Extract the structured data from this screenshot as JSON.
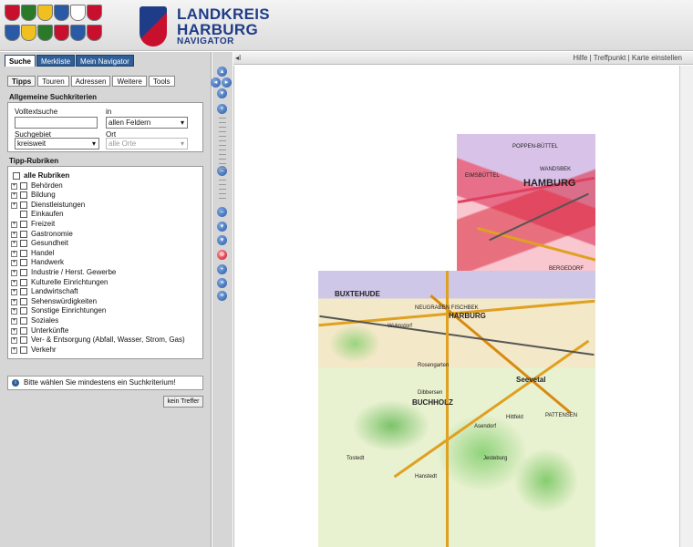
{
  "header": {
    "crests": [
      "#c8102e",
      "#2a7a2a",
      "#f0c020",
      "#2a5aa6",
      "#ffffff",
      "#c8102e",
      "#2a5aa6",
      "#f0c020",
      "#2a7a2a",
      "#c8102e",
      "#2a5aa6",
      "#c8102e"
    ],
    "logo": {
      "line1": "LANDKREIS",
      "line2": "HARBURG",
      "line3": "NAVIGATOR"
    }
  },
  "left": {
    "toptabs": [
      "Suche",
      "Merkliste",
      "Mein Navigator"
    ],
    "subtabs": [
      "Tipps",
      "Touren",
      "Adressen",
      "Weitere",
      "Tools"
    ],
    "general": {
      "title": "Allgemeine Suchkriterien",
      "volltext_label": "Volltextsuche",
      "volltext_value": "",
      "in_label": "in",
      "in_value": "allen Feldern",
      "suchgebiet_label": "Suchgebiet",
      "suchgebiet_value": "kreisweit",
      "ort_label": "Ort",
      "ort_value": "alle Orte"
    },
    "rubriken": {
      "title": "Tipp-Rubriken",
      "all_label": "alle Rubriken",
      "items": [
        "Behörden",
        "Bildung",
        "Dienstleistungen",
        "Einkaufen",
        "Freizeit",
        "Gastronomie",
        "Gesundheit",
        "Handel",
        "Handwerk",
        "Industrie / Herst. Gewerbe",
        "Kulturelle Einrichtungen",
        "Landwirtschaft",
        "Sehenswürdigkeiten",
        "Sonstige Einrichtungen",
        "Soziales",
        "Unterkünfte",
        "Ver- & Entsorgung (Abfall, Wasser, Strom, Gas)",
        "Verkehr"
      ]
    },
    "message": "Bitte wählen Sie mindestens ein Suchkriterium!",
    "button": "kein Treffer"
  },
  "toolbar": {
    "links": "Hilfe | Treffpunkt | Karte einstellen",
    "collapse": "◂I"
  },
  "map": {
    "labels": [
      "HAMBURG",
      "BUXTEHUDE",
      "BUCHHOLZ",
      "Seevetal",
      "NEUGRABEN FISCHBEK",
      "HARBURG",
      "WANDSBEK",
      "POPPEN-BÜTTEL",
      "EIMSBÜTTEL",
      "Wulmstorf",
      "Rosengarten",
      "Jesteburg",
      "Hanstedt",
      "Tostedt",
      "PATTENSEN",
      "BERGEDORF",
      "Hittfeld",
      "Asendorf",
      "Dibbersen"
    ]
  }
}
